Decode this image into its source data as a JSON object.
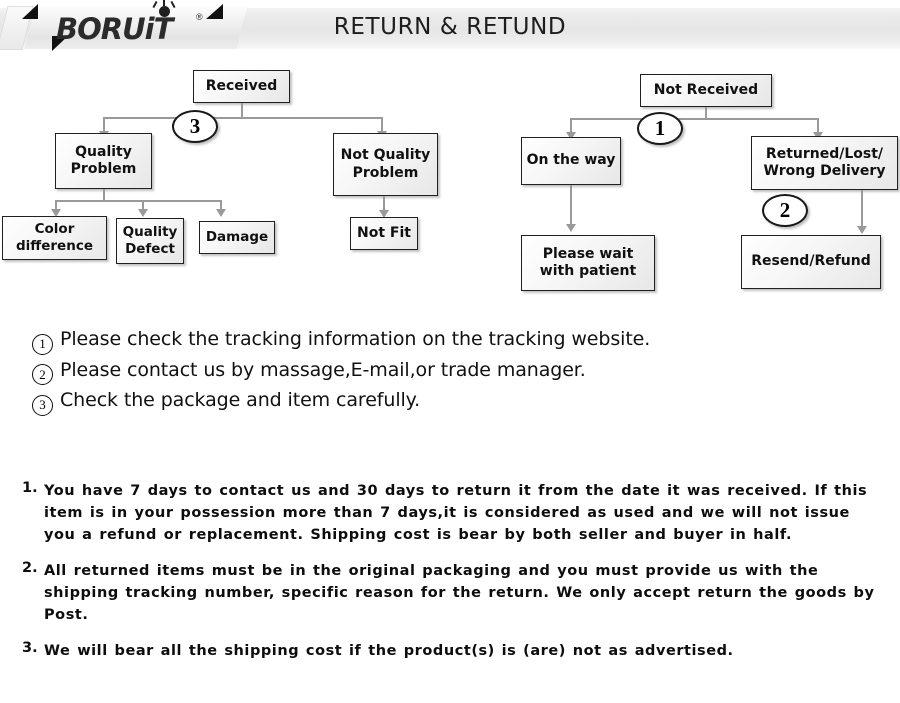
{
  "header": {
    "title": "RETURN & RETUND",
    "logo_text": "BORUiT",
    "logo_registered": "®"
  },
  "flowchart": {
    "left_tree": {
      "root": "Received",
      "marker": "3",
      "children": [
        {
          "label": "Quality\nProblem"
        },
        {
          "label": "Not Quality\nProblem"
        }
      ],
      "quality_problem_children": [
        {
          "label": "Color\ndifference"
        },
        {
          "label": "Quality\nDefect"
        },
        {
          "label": "Damage"
        }
      ],
      "not_quality_problem_child": {
        "label": "Not Fit"
      }
    },
    "right_tree": {
      "root": "Not  Received",
      "marker_1": "1",
      "marker_2": "2",
      "children": [
        {
          "label": "On the way"
        },
        {
          "label": "Returned/Lost/\nWrong Delivery"
        }
      ],
      "on_the_way_child": {
        "label": "Please wait\nwith patient"
      },
      "returned_child": {
        "label": "Resend/Refund"
      }
    }
  },
  "notes": [
    {
      "num": "1",
      "text": "Please check the tracking information on the tracking website."
    },
    {
      "num": "2",
      "text": "Please contact us by  massage,E-mail,or trade manager."
    },
    {
      "num": "3",
      "text": "Check the package and item carefully."
    }
  ],
  "policy": [
    {
      "num": "1.",
      "text": "You have 7 days to contact us and 30 days to return it from the date it was received. If this item is in your possession more than 7 days,it is considered as used and we will not issue you a refund or replacement. Shipping cost is bear by both seller and buyer in half."
    },
    {
      "num": "2.",
      "text": "All returned items must be in the original packaging and you must provide us with the shipping tracking number, specific reason for the return. We only accept return the goods by Post."
    },
    {
      "num": "3.",
      "text": "We will bear all the shipping cost if the product(s) is (are) not as advertised."
    }
  ],
  "colors": {
    "header_band": "#e8e8e8",
    "box_border": "#202020",
    "connector": "#9a9a9a",
    "text": "#111111"
  }
}
